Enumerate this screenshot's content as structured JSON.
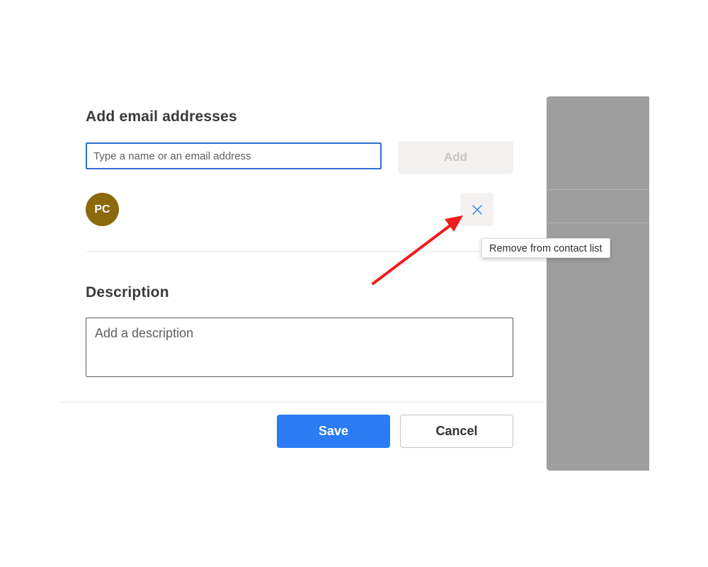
{
  "email_section": {
    "title": "Add email addresses",
    "input_placeholder": "Type a name or an email address",
    "input_value": "",
    "add_button_label": "Add"
  },
  "contacts": [
    {
      "initials": "PC",
      "avatar_color": "#8a6a0c",
      "remove_icon": "close-icon"
    }
  ],
  "tooltip": {
    "text": "Remove from contact list"
  },
  "description_section": {
    "title": "Description",
    "placeholder": "Add a description",
    "value": ""
  },
  "footer": {
    "save_label": "Save",
    "cancel_label": "Cancel"
  },
  "colors": {
    "accent": "#2b7cf3",
    "input_focus_border": "#2f6fd1",
    "annotation_arrow": "#ee1c1c",
    "overlay": "#9e9e9e"
  }
}
